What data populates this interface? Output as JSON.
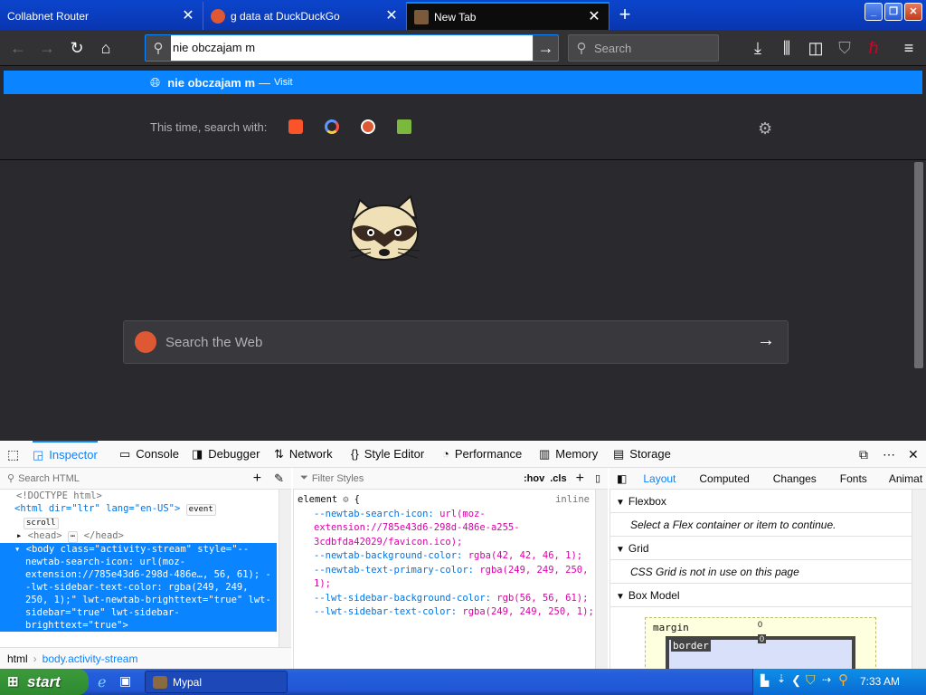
{
  "tabs": [
    {
      "label": "Collabnet Router",
      "active": false
    },
    {
      "label": "g data at DuckDuckGo",
      "active": false
    },
    {
      "label": "New Tab",
      "active": true
    }
  ],
  "toolbar": {
    "url_value": "nie obczajam m",
    "search_placeholder": "Search"
  },
  "autocomplete": {
    "suggestion_text": "nie obczajam m",
    "separator": "—",
    "suggestion_action": "Visit",
    "oneoff_label": "This time, search with:",
    "engines": [
      "brave-icon",
      "qwant-icon",
      "duckduckgo-icon",
      "mojeek-icon"
    ]
  },
  "content": {
    "web_search_placeholder": "Search the Web"
  },
  "devtools": {
    "tabs": [
      {
        "label": "Inspector",
        "icon": "inspector-icon",
        "selected": true
      },
      {
        "label": "Console",
        "icon": "console-icon"
      },
      {
        "label": "Debugger",
        "icon": "debugger-icon"
      },
      {
        "label": "Network",
        "icon": "network-icon"
      },
      {
        "label": "Style Editor",
        "icon": "style-editor-icon"
      },
      {
        "label": "Performance",
        "icon": "performance-icon"
      },
      {
        "label": "Memory",
        "icon": "memory-icon"
      },
      {
        "label": "Storage",
        "icon": "storage-icon"
      }
    ],
    "search_html_placeholder": "Search HTML",
    "filter_styles_placeholder": "Filter Styles",
    "hov_label": ":hov",
    "cls_label": ".cls",
    "markup": {
      "doctype": "<!DOCTYPE html>",
      "html_open": "<html dir=\"ltr\" lang=\"en-US\">",
      "event_badge": "event",
      "scroll_badge": "scroll",
      "head": "<head>",
      "head_close": "</head>",
      "body": "<body class=\"activity-stream\" style=\"--newtab-search-icon: url(moz-extension://785e43d6-298d-486e…, 56, 61); --lwt-sidebar-text-color: rgba(249, 249, 250, 1);\" lwt-newtab-brighttext=\"true\" lwt-sidebar=\"true\" lwt-sidebar-brighttext=\"true\">"
    },
    "breadcrumbs": [
      "html",
      "body.activity-stream"
    ],
    "rules": {
      "selector": "element",
      "brace_open": "{",
      "source": "inline",
      "declarations": [
        {
          "prop": "--newtab-search-icon:",
          "value": "url(moz-extension://785e43d6-298d-486e-a255-3cdbfda42029/favicon.ico);"
        },
        {
          "prop": "--newtab-background-color:",
          "value": "rgba(42, 42, 46, 1);"
        },
        {
          "prop": "--newtab-text-primary-color:",
          "value": "rgba(249, 249, 250, 1);"
        },
        {
          "prop": "--lwt-sidebar-background-color:",
          "value": "rgb(56, 56, 61);"
        },
        {
          "prop": "--lwt-sidebar-text-color:",
          "value": "rgba(249, 249, 250, 1);"
        }
      ]
    },
    "layout_tabs": [
      "Layout",
      "Computed",
      "Changes",
      "Fonts",
      "Animat"
    ],
    "layout": {
      "flexbox_title": "Flexbox",
      "flexbox_msg": "Select a Flex container or item to continue.",
      "grid_title": "Grid",
      "grid_msg": "CSS Grid is not in use on this page",
      "boxmodel_title": "Box Model",
      "margin_label": "margin",
      "border_label": "border",
      "margin_value": "0",
      "border_value": "0"
    }
  },
  "taskbar": {
    "start_label": "start",
    "task_label": "Mypal",
    "clock": "7:33 AM"
  }
}
